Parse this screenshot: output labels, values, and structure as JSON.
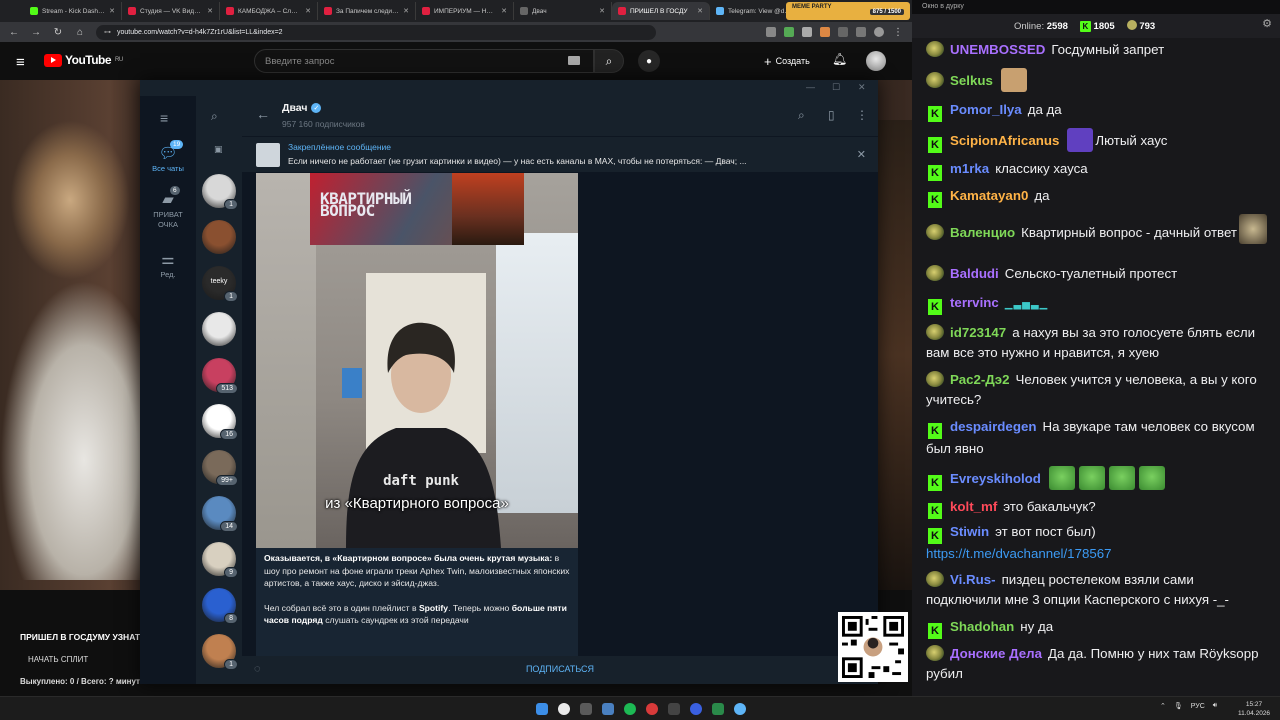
{
  "browser": {
    "tabs": [
      {
        "title": "Stream - Kick Dashboard",
        "color": "#53fc18"
      },
      {
        "title": "Студия — VK Видео | Live",
        "color": "#e02040"
      },
      {
        "title": "КАМБОДЖА – Сложная",
        "color": "#e02040"
      },
      {
        "title": "За Папичем следит в д",
        "color": "#e02040"
      },
      {
        "title": "ИМПЕРИУМ — НЕ РО",
        "color": "#e02040"
      },
      {
        "title": "Двач",
        "color": "#666666"
      },
      {
        "title": "ПРИШЕЛ В ГОСДУ",
        "color": "#e02040",
        "active": true
      },
      {
        "title": "Telegram: View @dvach",
        "color": "#5eb5f7"
      }
    ],
    "new_tab": "+",
    "url": "youtube.com/watch?v=d-h4k7Zr1rU&list=LL&index=2"
  },
  "youtube": {
    "logo": "YouTube",
    "region": "RU",
    "search_placeholder": "Введите запрос",
    "create_label": "Создать",
    "title": "ПРИШЕЛ В ГОСДУМУ УЗНАТ",
    "split_label": "НАЧАТЬ СПЛИТ",
    "sold_label": "Выкуплено: 0 / Всего: ? минут"
  },
  "telegram": {
    "folders": [
      {
        "label": "Все чаты",
        "badge": "19",
        "active": true
      },
      {
        "label": "ПРИВАТ ОЧКА",
        "badge": "6"
      },
      {
        "label": "Ред."
      }
    ],
    "chats": [
      {
        "badge": "1",
        "color": "#d8d8d8"
      },
      {
        "badge": "",
        "color": "#8a5030"
      },
      {
        "badge": "1",
        "color": "#2a2a2a",
        "text": "teeky"
      },
      {
        "badge": "",
        "color": "#e8e8e8"
      },
      {
        "badge": "513",
        "color": "#c84060"
      },
      {
        "badge": "16",
        "color": "#ffffff"
      },
      {
        "badge": "99+",
        "color": "#7a6a5a"
      },
      {
        "badge": "14",
        "color": "#5a8ac0"
      },
      {
        "badge": "9",
        "color": "#d8d0c0"
      },
      {
        "badge": "8",
        "color": "#2a60d0"
      },
      {
        "badge": "1",
        "color": "#c08050"
      }
    ],
    "channel": {
      "name": "Двач",
      "subscribers": "957 160 подписчиков"
    },
    "pinned": {
      "title": "Закреплённое сообщение",
      "text": "Если ничего не работает (не грузит картинки и видео) — у нас есть каналы в MAX, чтобы не потеряться:  — Двач; ..."
    },
    "post": {
      "logo_text": "КВАРТИРНЫЙ ВОПРОС",
      "hoodie_text": "daft punk",
      "caption": "из «Квартирного вопроса»",
      "p1_bold": "Оказывается, в «Квартирном вопросе» была очень крутая музыка:",
      "p1_rest": " в шоу про ремонт на фоне играли треки Aphex Twin, малоизвестных японских артистов, а также хаус, диско и эйсид-джаз.",
      "p2_a": "Чел собрал всё это в один плейлист в ",
      "p2_spotify": "Spotify",
      "p2_b": ". Теперь можно ",
      "p2_bold": "больше пяти часов подряд",
      "p2_c": " слушать саундрек из этой передачи"
    },
    "subscribe": "ПОДПИСАТЬСЯ"
  },
  "chat": {
    "window_title": "Окно в дурку",
    "online_label": "Online:",
    "online": "2598",
    "kick_count": "1805",
    "other_count": "793",
    "messages": [
      {
        "badge": "f",
        "user": "UNEMBOSSED",
        "color": "#a970ff",
        "text": "Госдумный запрет"
      },
      {
        "badge": "f",
        "user": "Selkus",
        "color": "#7fd858",
        "text": "",
        "emote": "#c8a070"
      },
      {
        "badge": "k",
        "user": "Pomor_Ilya",
        "color": "#6a8cff",
        "text": "да да"
      },
      {
        "badge": "k",
        "user": "ScipionAfricanus",
        "color": "#ffb347",
        "text": "Лютый хаус",
        "emote": "#6040c0"
      },
      {
        "badge": "k",
        "user": "m1rka",
        "color": "#6a8cff",
        "text": "классику хауса"
      },
      {
        "badge": "k",
        "user": "Kamatayan0",
        "color": "#ffb347",
        "text": "да"
      },
      {
        "badge": "f",
        "user": "Валенцио",
        "color": "#7fd858",
        "text": "Квартирный вопрос - дачный ответ"
      },
      {
        "badge": "f",
        "user": "Baldudi",
        "color": "#a970ff",
        "text": "Сельско-туалетный протест"
      },
      {
        "badge": "k",
        "user": "terrvinc",
        "color": "#a970ff",
        "text": ""
      },
      {
        "badge": "f",
        "user": "id723147",
        "color": "#7fd858",
        "text": "а нахуя вы за это голосуете блять если вам все это нужно и нравится, я хуею"
      },
      {
        "badge": "f",
        "user": "Рас2-Дэ2",
        "color": "#7fd858",
        "text": "Человек учится у человека, а вы у кого учитесь?"
      },
      {
        "badge": "k",
        "user": "despairdegen",
        "color": "#6a8cff",
        "text": "На звукаре там человек со вкусом был явно"
      },
      {
        "badge": "k",
        "user": "Evreyskiholod",
        "color": "#6a8cff",
        "text": ""
      },
      {
        "badge": "k",
        "user": "kolt_mf",
        "color": "#ff4a5a",
        "text": "это бакальчук?"
      },
      {
        "badge": "k",
        "user": "Stiwin",
        "color": "#6a8cff",
        "text": "эт вот пост был)",
        "link": "https://t.me/dvachannel/178567"
      },
      {
        "badge": "f",
        "user": "Vi.Rus-",
        "color": "#6a8cff",
        "text": "пиздец ростелеком взяли сами подключили мне 3 опции Касперского с нихуя -_-"
      },
      {
        "badge": "k",
        "user": "Shadohan",
        "color": "#7fd858",
        "text": "ну да"
      },
      {
        "badge": "f",
        "user": "Донские Дела",
        "color": "#a970ff",
        "text": "Да да. Помню у них там Röyksopp рубил"
      }
    ]
  },
  "taskbar": {
    "widget_title": "MEME PARTY",
    "widget_value": "875 / 1500",
    "lang": "РУС",
    "time": "15:27",
    "date": "11.04.2026"
  }
}
